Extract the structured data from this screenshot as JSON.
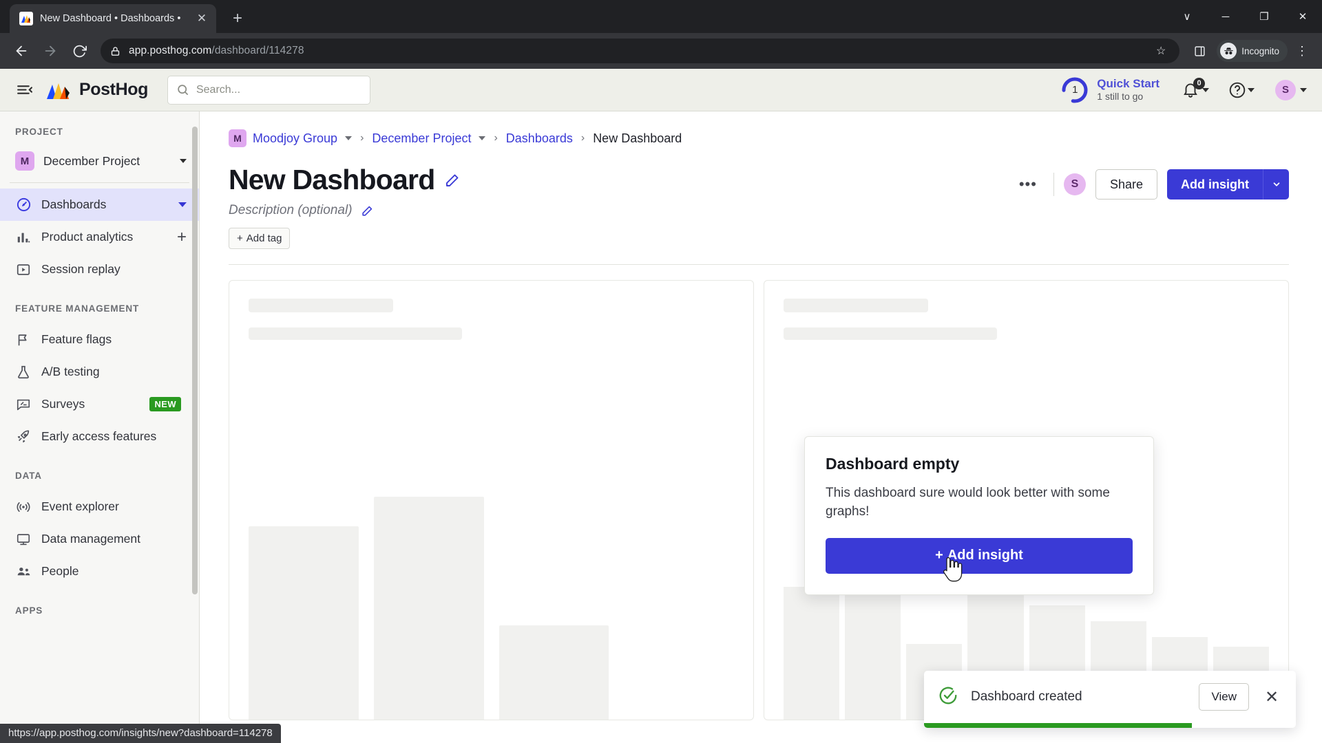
{
  "browser": {
    "tab": {
      "title": "New Dashboard • Dashboards •",
      "favicon_name": "posthog-favicon",
      "close_label": "✕",
      "newtab_label": "+"
    },
    "window_controls": {
      "list_label": "∨",
      "minimize_label": "─",
      "maximize_label": "❐",
      "close_label": "✕"
    },
    "toolbar": {
      "back_label": "←",
      "forward_label": "→",
      "reload_label": "↻",
      "url_host": "app.posthog.com",
      "url_path": "/dashboard/114278",
      "bookmark_label": "☆",
      "sidepanel_label": "▧",
      "profile_label": "Incognito",
      "menu_label": "⋮"
    },
    "status_url": "https://app.posthog.com/insights/new?dashboard=114278"
  },
  "topbar": {
    "menu_icon": "hamburger-icon",
    "brand": "PostHog",
    "search": {
      "placeholder": "Search...",
      "value": ""
    },
    "quick_start": {
      "title": "Quick Start",
      "subtitle": "1 still to go",
      "ring_value": "1"
    },
    "notifications_count": "0",
    "help_label": "?",
    "avatar_initial": "S"
  },
  "sidebar": {
    "sections": [
      {
        "label": "PROJECT",
        "project": {
          "badge": "M",
          "name": "December Project"
        },
        "items": [
          {
            "label": "Dashboards",
            "icon": "dashboards-icon",
            "active": true,
            "trailing": "caret"
          },
          {
            "label": "Product analytics",
            "icon": "bar-chart-icon",
            "active": false,
            "trailing": "plus"
          },
          {
            "label": "Session replay",
            "icon": "play-square-icon",
            "active": false,
            "trailing": ""
          }
        ]
      },
      {
        "label": "FEATURE MANAGEMENT",
        "items": [
          {
            "label": "Feature flags",
            "icon": "flag-icon",
            "active": false,
            "trailing": ""
          },
          {
            "label": "A/B testing",
            "icon": "flask-icon",
            "active": false,
            "trailing": ""
          },
          {
            "label": "Surveys",
            "icon": "survey-icon",
            "active": false,
            "trailing": "badge",
            "badge": "NEW"
          },
          {
            "label": "Early access features",
            "icon": "rocket-icon",
            "active": false,
            "trailing": ""
          }
        ]
      },
      {
        "label": "DATA",
        "items": [
          {
            "label": "Event explorer",
            "icon": "broadcast-icon",
            "active": false,
            "trailing": ""
          },
          {
            "label": "Data management",
            "icon": "database-icon",
            "active": false,
            "trailing": ""
          },
          {
            "label": "People",
            "icon": "people-icon",
            "active": false,
            "trailing": ""
          }
        ]
      },
      {
        "label": "APPS",
        "items": []
      }
    ]
  },
  "breadcrumb": {
    "org_badge": "M",
    "items": [
      {
        "label": "Moodjoy Group",
        "link": true,
        "caret": true
      },
      {
        "label": "December Project",
        "link": true,
        "caret": true
      },
      {
        "label": "Dashboards",
        "link": true,
        "caret": false
      },
      {
        "label": "New Dashboard",
        "link": false,
        "caret": false
      }
    ],
    "separator": "›"
  },
  "page": {
    "title": "New Dashboard",
    "edit_title_icon": "pencil-icon",
    "description_placeholder": "Description (optional)",
    "edit_description_icon": "pencil-icon",
    "add_tag_label": "Add tag",
    "add_tag_plus": "+",
    "more_label": "•••",
    "collaborator_initial": "S",
    "share_label": "Share",
    "add_insight_label": "Add insight",
    "add_insight_caret": "▾"
  },
  "popover": {
    "title": "Dashboard empty",
    "body": "This dashboard sure would look better with some graphs!",
    "button_plus": "+",
    "button_label": "Add insight"
  },
  "toast": {
    "icon": "check-circle-icon",
    "message": "Dashboard created",
    "view_label": "View",
    "close_label": "✕",
    "progress_percent": 72,
    "accent_color": "#2a9a20"
  },
  "skeleton": {
    "left_card_bars": [
      42,
      62,
      28,
      0
    ],
    "right_card_bars": [
      56,
      60,
      28,
      70,
      50,
      42,
      34,
      30
    ]
  },
  "colors": {
    "primary": "#3a3ad6",
    "success": "#2a9a20",
    "avatar": "#e6b8f0",
    "sidebar_active": "#e2e2fb"
  }
}
